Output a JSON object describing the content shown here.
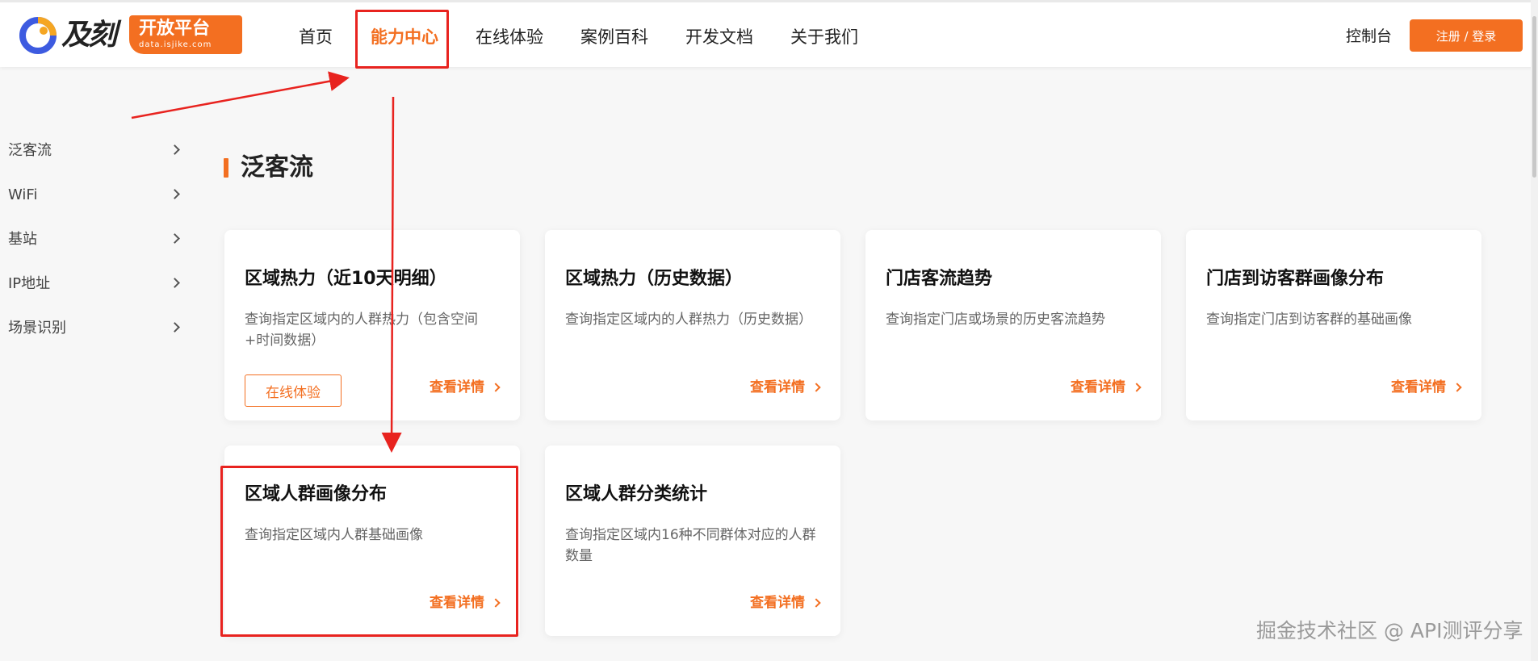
{
  "brand": {
    "logo_word": "及刻",
    "tag_title": "开放平台",
    "tag_subtitle": "data.isjike.com"
  },
  "nav": {
    "items": [
      {
        "label": "首页"
      },
      {
        "label": "能力中心",
        "active": true
      },
      {
        "label": "在线体验"
      },
      {
        "label": "案例百科"
      },
      {
        "label": "开发文档"
      },
      {
        "label": "关于我们"
      }
    ],
    "console_label": "控制台",
    "login_label": "注册 / 登录"
  },
  "sidebar": {
    "items": [
      {
        "label": "泛客流"
      },
      {
        "label": "WiFi"
      },
      {
        "label": "基站"
      },
      {
        "label": "IP地址"
      },
      {
        "label": "场景识别"
      }
    ]
  },
  "section": {
    "title": "泛客流"
  },
  "cards": [
    {
      "title": "区域热力（近10天明细）",
      "desc": "查询指定区域内的人群热力（包含空间+时间数据）",
      "try_label": "在线体验",
      "detail_label": "查看详情"
    },
    {
      "title": "区域热力（历史数据）",
      "desc": "查询指定区域内的人群热力（历史数据）",
      "detail_label": "查看详情"
    },
    {
      "title": "门店客流趋势",
      "desc": "查询指定门店或场景的历史客流趋势",
      "detail_label": "查看详情"
    },
    {
      "title": "门店到访客群画像分布",
      "desc": "查询指定门店到访客群的基础画像",
      "detail_label": "查看详情"
    },
    {
      "title": "区域人群画像分布",
      "desc": "查询指定区域内人群基础画像",
      "detail_label": "查看详情"
    },
    {
      "title": "区域人群分类统计",
      "desc": "查询指定区域内16种不同群体对应的人群数量",
      "detail_label": "查看详情"
    }
  ],
  "colors": {
    "accent": "#f36f21",
    "annotation": "#e8231f"
  },
  "watermark": "掘金技术社区 @ API测评分享"
}
